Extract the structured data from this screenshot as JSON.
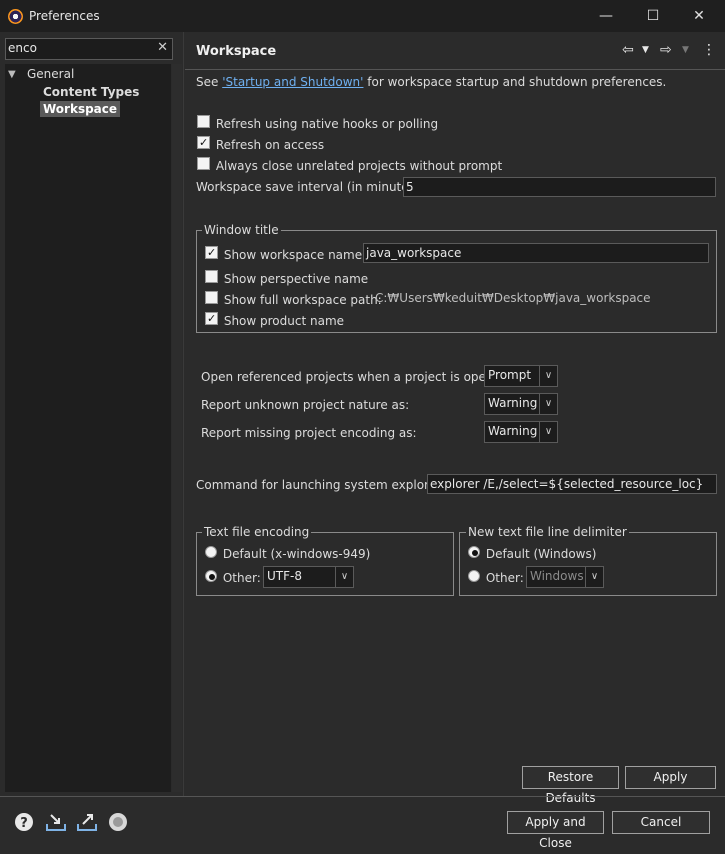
{
  "window": {
    "title": "Preferences",
    "minimize": "—",
    "maximize": "☐",
    "close": "✕"
  },
  "sidebar": {
    "filter_value": "enco",
    "filter_clear": "✕",
    "tree": {
      "general": "General",
      "content_types": "Content Types",
      "workspace": "Workspace"
    }
  },
  "page": {
    "title": "Workspace",
    "intro_prefix": "See ",
    "intro_link": "'Startup and Shutdown'",
    "intro_suffix": " for workspace startup and shutdown preferences.",
    "refresh_native": {
      "label": "Refresh using native hooks or polling",
      "checked": false
    },
    "refresh_access": {
      "label": "Refresh on access",
      "checked": true
    },
    "always_close": {
      "label": "Always close unrelated projects without prompt",
      "checked": false
    },
    "save_interval_label": "Workspace save interval (in minutes):",
    "save_interval_value": "5",
    "window_title_group": {
      "label": "Window title",
      "show_workspace_name": "Show workspace name:",
      "workspace_name_value": "java_workspace",
      "show_perspective_name": "Show perspective name",
      "show_full_path": "Show full workspace path:",
      "full_path_value": "C:₩Users₩keduit₩Desktop₩java_workspace",
      "show_product_name": "Show product name"
    },
    "open_referenced_label": "Open referenced projects when a project is opened:",
    "open_referenced_value": "Prompt",
    "unknown_nature_label": "Report unknown project nature as:",
    "unknown_nature_value": "Warning",
    "missing_encoding_label": "Report missing project encoding as:",
    "missing_encoding_value": "Warning",
    "explorer_label": "Command for launching system explorer:",
    "explorer_value": "explorer /E,/select=${selected_resource_loc}",
    "encoding_group": {
      "label": "Text file encoding",
      "default": "Default (x-windows-949)",
      "other": "Other:",
      "other_value": "UTF-8"
    },
    "delimiter_group": {
      "label": "New text file line delimiter",
      "default": "Default (Windows)",
      "other": "Other:",
      "other_value": "Windows"
    },
    "restore_defaults": "Restore Defaults",
    "apply": "Apply"
  },
  "footer": {
    "apply_close": "Apply and Close",
    "cancel": "Cancel",
    "help_icon": "?"
  }
}
